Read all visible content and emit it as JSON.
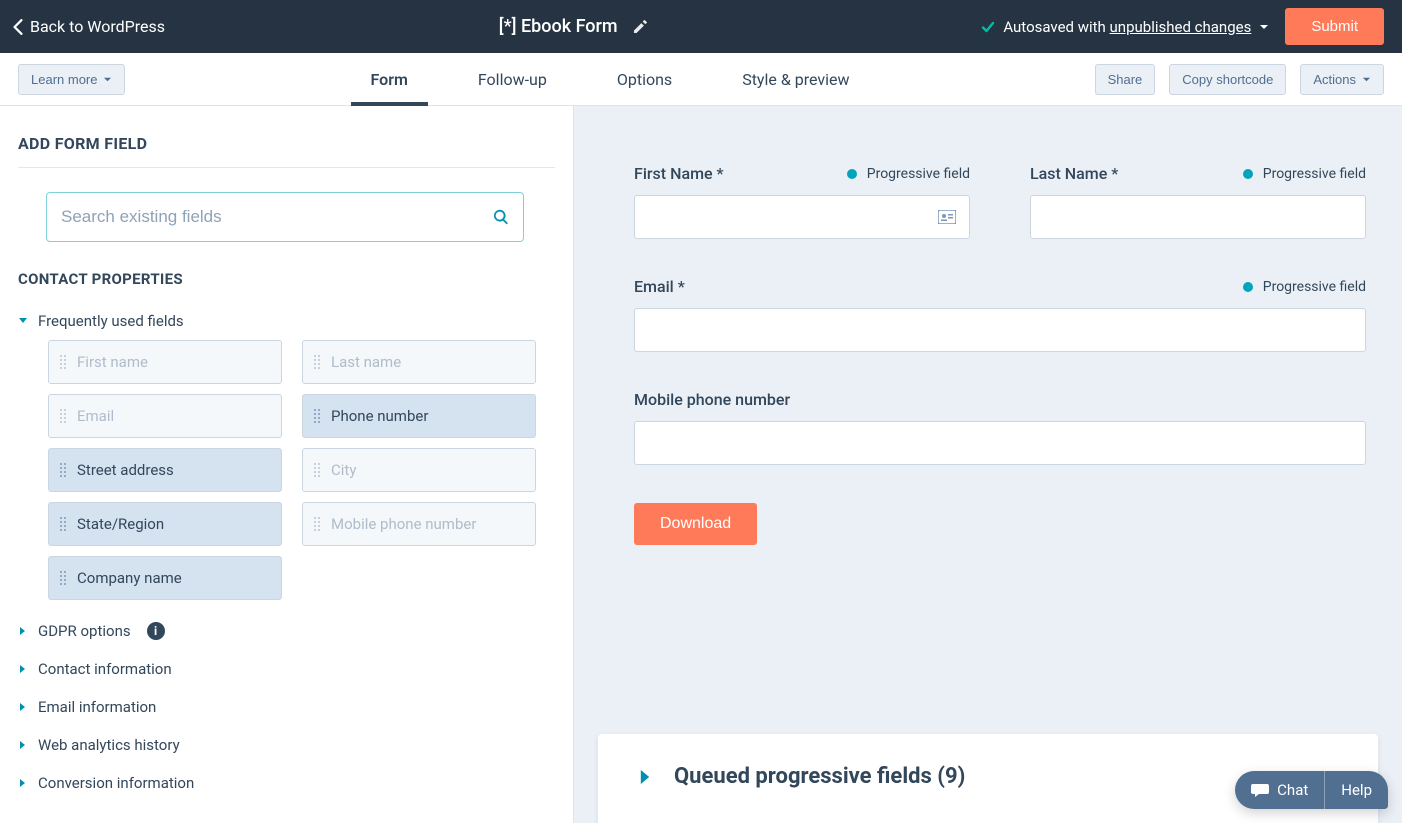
{
  "topbar": {
    "back_label": "Back to WordPress",
    "title": "[*] Ebook Form",
    "autosave_prefix": "Autosaved with ",
    "autosave_link": "unpublished changes",
    "submit_label": "Submit"
  },
  "navbar": {
    "learn_more": "Learn more",
    "tabs": {
      "form": "Form",
      "followup": "Follow-up",
      "options": "Options",
      "style": "Style & preview"
    },
    "share": "Share",
    "copy_shortcode": "Copy shortcode",
    "actions": "Actions"
  },
  "sidebar": {
    "add_heading": "ADD FORM FIELD",
    "search_placeholder": "Search existing fields",
    "contact_heading": "CONTACT PROPERTIES",
    "tree": {
      "frequently": "Frequently used fields",
      "gdpr": "GDPR options",
      "contact_info": "Contact information",
      "email_info": "Email information",
      "web": "Web analytics history",
      "conversion": "Conversion information"
    },
    "fields": {
      "first_name": "First name",
      "last_name": "Last name",
      "email": "Email",
      "phone": "Phone number",
      "street": "Street address",
      "city": "City",
      "state": "State/Region",
      "mobile": "Mobile phone number",
      "company": "Company name"
    }
  },
  "canvas": {
    "first_name": "First Name *",
    "last_name": "Last Name *",
    "email": "Email *",
    "mobile": "Mobile phone number",
    "progressive": "Progressive field",
    "download": "Download",
    "queued": "Queued progressive fields (9)"
  },
  "help": {
    "chat": "Chat",
    "help": "Help"
  }
}
